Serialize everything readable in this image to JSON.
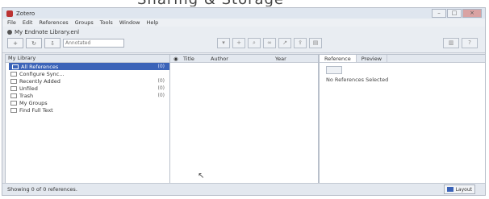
{
  "overhang": {
    "text": "Sharing & Storage"
  },
  "window": {
    "title": "Zotero",
    "buttons": [
      "–",
      "□",
      "×"
    ]
  },
  "menu": [
    "File",
    "Edit",
    "References",
    "Groups",
    "Tools",
    "Window",
    "Help"
  ],
  "toolbar": {
    "library_title": "My Endnote Library.enl",
    "search_placeholder": "Annotated"
  },
  "tree": {
    "header": "My Library",
    "items": [
      {
        "label": "All References",
        "count": "(0)",
        "selected": true
      },
      {
        "label": "Configure Sync...",
        "count": ""
      },
      {
        "label": "Recently Added",
        "count": "(0)"
      },
      {
        "label": "Unfiled",
        "count": "(0)"
      },
      {
        "label": "Trash",
        "count": "(0)"
      },
      {
        "label": "My Groups",
        "count": ""
      },
      {
        "label": "Find Full Text",
        "count": ""
      }
    ]
  },
  "list": {
    "columns": {
      "author": "Author",
      "year": "Year",
      "title": "Title"
    }
  },
  "info": {
    "tabs": [
      "Reference",
      "Preview"
    ],
    "message": "No References Selected"
  },
  "status": {
    "text": "Showing 0 of 0 references.",
    "layout_label": "Layout"
  }
}
